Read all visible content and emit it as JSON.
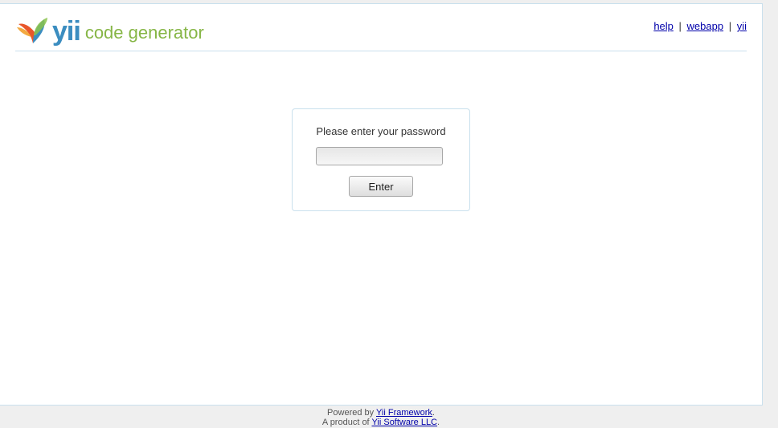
{
  "header": {
    "logo_brand": "yii",
    "logo_text": "code generator",
    "links": {
      "help": "help",
      "webapp": "webapp",
      "yii": "yii",
      "separator": "|"
    }
  },
  "login": {
    "prompt": "Please enter your password",
    "password_value": "",
    "enter_label": "Enter"
  },
  "footer": {
    "powered_prefix": "Powered by",
    "powered_link": "Yii Framework",
    "powered_suffix": ".",
    "product_prefix": "A product of",
    "product_link": "Yii Software LLC",
    "product_suffix": "."
  },
  "colors": {
    "border": "#c9e0ed",
    "logo_text": "#86b646",
    "link": "#0000aa"
  }
}
